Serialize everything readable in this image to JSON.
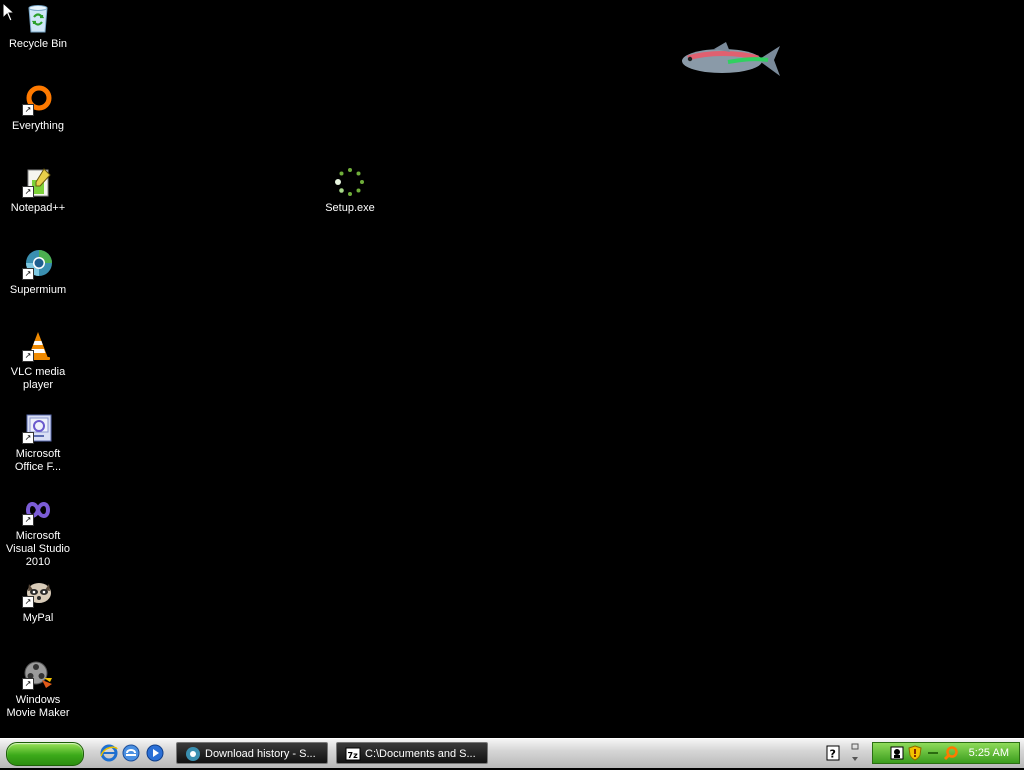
{
  "desktop": {
    "icons": [
      {
        "label": "Recycle Bin",
        "icon": "recycle-bin-icon"
      },
      {
        "label": "Everything",
        "icon": "everything-search-icon"
      },
      {
        "label": "Notepad++",
        "icon": "notepad-plus-plus-icon"
      },
      {
        "label": "Supermium",
        "icon": "supermium-browser-icon"
      },
      {
        "label": "VLC media player",
        "icon": "vlc-cone-icon"
      },
      {
        "label": "Microsoft Office F...",
        "icon": "office-picture-icon"
      },
      {
        "label": "Microsoft Visual Studio 2010",
        "icon": "visual-studio-icon"
      },
      {
        "label": "MyPal",
        "icon": "mypal-raccoon-icon"
      },
      {
        "label": "Windows Movie Maker",
        "icon": "movie-maker-icon"
      },
      {
        "label": "Setup.exe",
        "icon": "setup-loading-icon"
      }
    ]
  },
  "taskbar": {
    "quick_launch": [
      "internet-explorer-icon",
      "show-desktop-icon",
      "media-player-icon"
    ],
    "tasks": [
      {
        "label": "Download history - S...",
        "icon": "browser-icon"
      },
      {
        "label": "C:\\Documents and S...",
        "icon": "7zip-icon"
      }
    ],
    "help_icon": "help-icon",
    "clock": "5:25 AM"
  },
  "colors": {
    "desktop_bg": "#000000",
    "start_green": "#3caa1a",
    "tray_green": "#5fbd35"
  }
}
